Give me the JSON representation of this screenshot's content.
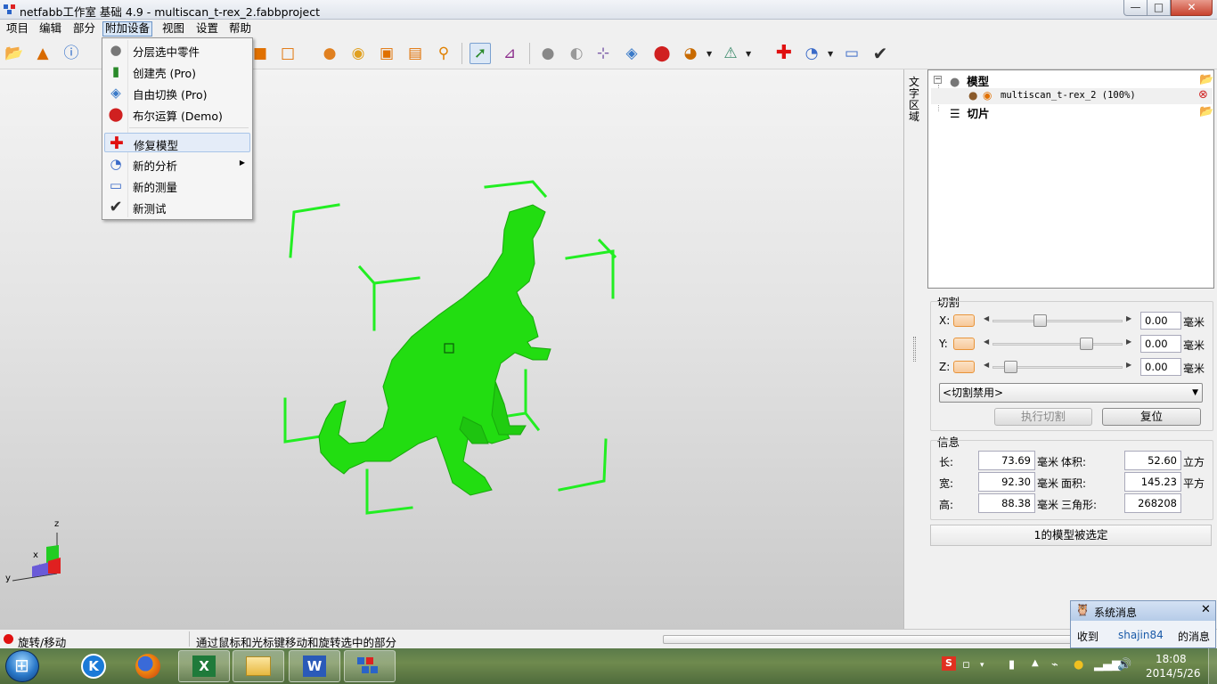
{
  "window": {
    "title": "netfabb工作室 基础 4.9 - multiscan_t-rex_2.fabbproject",
    "min_icon": "—",
    "max_icon": "□",
    "close_icon": "✕"
  },
  "menubar": [
    {
      "label": "项目"
    },
    {
      "label": "编辑"
    },
    {
      "label": "部分"
    },
    {
      "label": "附加设备",
      "active": true
    },
    {
      "label": "视图"
    },
    {
      "label": "设置"
    },
    {
      "label": "帮助"
    }
  ],
  "toolbar": {
    "icons": [
      "open-folder-icon",
      "add-part-icon",
      "part-info-icon",
      "cube-icon",
      "box-icon",
      "spheres-icon",
      "sphere-icon",
      "frame-icon",
      "frame-zoom-icon",
      "magnifier-icon",
      "select-cursor-icon",
      "axes-icon",
      "sphere-white-icon",
      "rotate-icon",
      "measure-icon",
      "cut-plane-icon",
      "boolean-icon",
      "section-icon",
      "warning-icon",
      "repair-cross-icon",
      "analysis-icon",
      "ruler-icon",
      "check-icon"
    ]
  },
  "dropdown": {
    "items": [
      {
        "label": "分层选中零件",
        "icon": "slice-sphere-icon"
      },
      {
        "label": "创建壳 (Pro)",
        "icon": "shell-icon"
      },
      {
        "label": "自由切换 (Pro)",
        "icon": "free-cut-icon"
      },
      {
        "label": "布尔运算 (Demo)",
        "icon": "boolean-icon"
      },
      {
        "label": "修复模型",
        "icon": "repair-cross-icon",
        "highlighted": true
      },
      {
        "label": "新的分析",
        "icon": "analysis-icon",
        "submenu": true
      },
      {
        "label": "新的测量",
        "icon": "ruler-icon"
      },
      {
        "label": "新测试",
        "icon": "check-icon"
      }
    ]
  },
  "vtab": {
    "label": "文字区域"
  },
  "tree": {
    "root_label": "模型",
    "part_label": "multiscan_t-rex_2 (100%)",
    "slices_label": "切片",
    "expander": "−"
  },
  "cut": {
    "title": "切割",
    "axes": [
      {
        "name": "X:",
        "value": "0.00",
        "unit": "毫米",
        "position": 0.35
      },
      {
        "name": "Y:",
        "value": "0.00",
        "unit": "毫米",
        "position": 0.75
      },
      {
        "name": "Z:",
        "value": "0.00",
        "unit": "毫米",
        "position": 0.1
      }
    ],
    "mode": "<切割禁用>",
    "execute_button": "执行切割",
    "reset_button": "复位"
  },
  "info": {
    "title": "信息",
    "length_label": "长:",
    "length": "73.69",
    "length_unit": "毫米",
    "width_label": "宽:",
    "width": "92.30",
    "width_unit": "毫米",
    "height_label": "高:",
    "height": "88.38",
    "height_unit": "毫米",
    "volume_label": "体积:",
    "volume": "52.60",
    "volume_unit": "立方",
    "area_label": "面积:",
    "area": "145.23",
    "area_unit": "平方",
    "triangles_label": "三角形:",
    "triangles": "268208",
    "selection_status": "1的模型被选定"
  },
  "axes_indicator": {
    "z": "z",
    "x": "x",
    "y": "y"
  },
  "statusbar": {
    "mode": "旋转/移动",
    "hint": "通过鼠标和光标键移动和旋转选中的部分"
  },
  "notification": {
    "title": "系统消息",
    "prefix": "收到",
    "user": "shajin84",
    "suffix": "的消息",
    "close": "✕"
  },
  "taskbar": {
    "apps": [
      "kugou-icon",
      "firefox-icon",
      "excel-icon",
      "explorer-icon",
      "word-icon",
      "netfabb-icon"
    ],
    "time": "18:08",
    "date": "2014/5/26"
  },
  "colors": {
    "model": "#22dd11",
    "bounding_box": "#22ee22",
    "accent": "#e8943a"
  }
}
